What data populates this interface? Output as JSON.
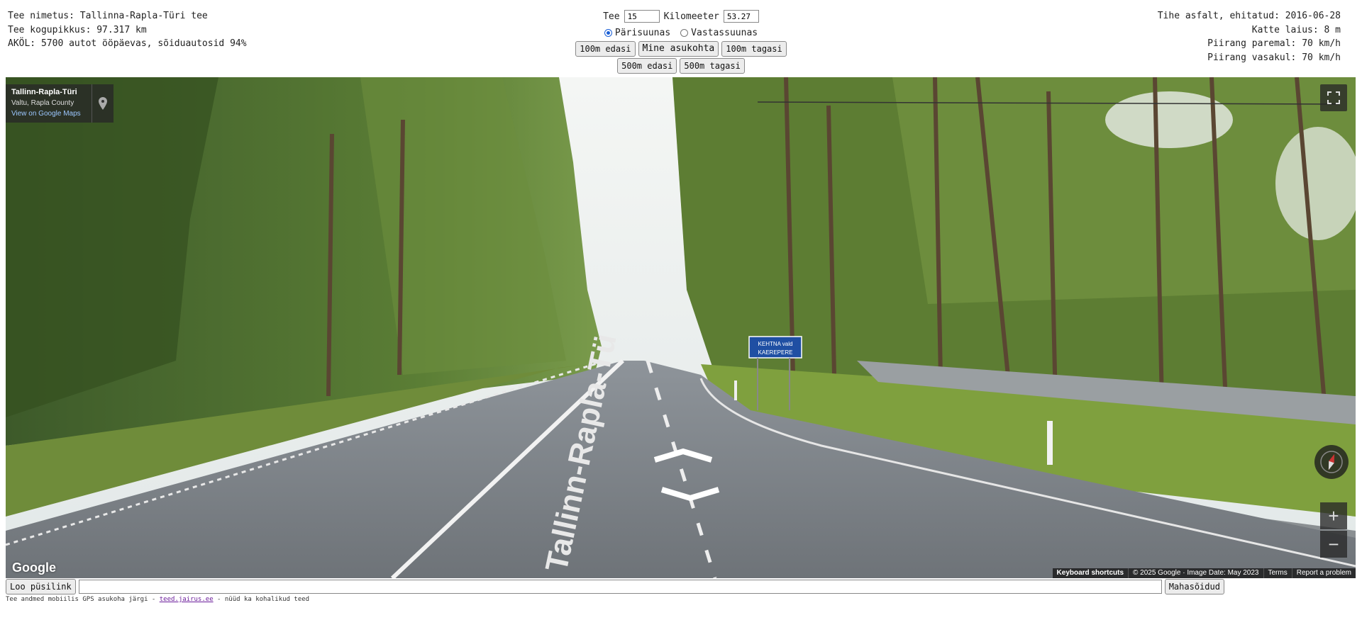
{
  "road_info": {
    "name_line": "Tee nimetus: Tallinna-Rapla-Türi tee",
    "length_line": "Tee kogupikkus: 97.317 km",
    "traffic_line": "AKÖL: 5700 autot ööpäevas, sõiduautosid 94%"
  },
  "surface_info": {
    "surface_line": "Tihe asfalt, ehitatud: 2016-06-28",
    "width_line": "Katte laius: 8 m",
    "limit_right_line": "Piirang paremal: 70 km/h",
    "limit_left_line": "Piirang vasakul: 70 km/h"
  },
  "controls": {
    "road_label": "Tee",
    "road_value": "15",
    "km_label": "Kilomeeter",
    "km_value": "53.27",
    "direction_forward": "Pärisuunas",
    "direction_backward": "Vastassuunas",
    "direction_selected": "forward",
    "btn_100_forward": "100m edasi",
    "btn_go": "Mine asukohta",
    "btn_100_back": "100m tagasi",
    "btn_500_forward": "500m edasi",
    "btn_500_back": "500m tagasi"
  },
  "streetview": {
    "location_title": "Tallinn-Rapla-Türi",
    "location_subtitle": "Valtu, Rapla County",
    "maps_link": "View on Google Maps",
    "sign_text_1": "KEHTNA vald",
    "sign_text_2": "KAEREPERE",
    "road_marking": "Tallinn-Rapla-Tü",
    "google_logo": "Google",
    "keyboard_shortcuts": "Keyboard shortcuts",
    "copyright": "© 2025 Google · Image Date: May 2023",
    "terms": "Terms",
    "report": "Report a problem",
    "zoom_in": "+",
    "zoom_out": "−",
    "icons": [
      "pin-icon",
      "fullscreen-icon",
      "compass-icon"
    ]
  },
  "bottom": {
    "permalink_button": "Loo püsilink",
    "permalink_value": "",
    "mahasoidud_button": "Mahasõidud",
    "footer_prefix": "Tee andmed mobiilis GPS asukoha järgi - ",
    "footer_link": "teed.jairus.ee",
    "footer_suffix": " - nüüd ka kohalikud teed"
  }
}
